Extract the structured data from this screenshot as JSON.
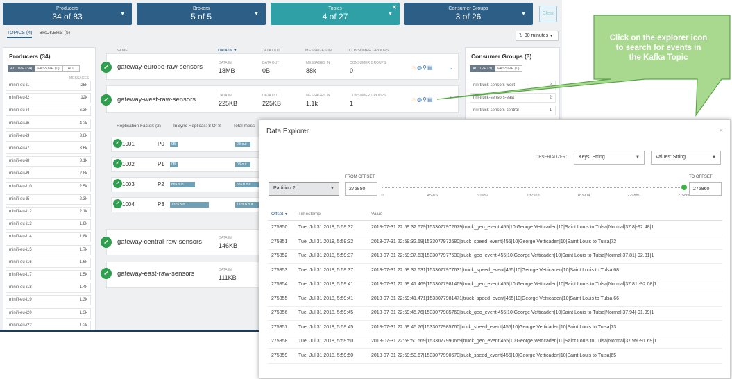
{
  "filters": [
    {
      "label": "Producers",
      "value": "34 of 83"
    },
    {
      "label": "Brokers",
      "value": "5 of 5"
    },
    {
      "label": "Topics",
      "value": "4 of 27"
    },
    {
      "label": "Consumer Groups",
      "value": "3 of 26"
    }
  ],
  "clear_label": "Clear",
  "tabs": {
    "topics": "TOPICS (4)",
    "brokers": "BROKERS (5)"
  },
  "time_range": "30 minutes",
  "producers": {
    "title": "Producers (34)",
    "segments": [
      "ACTIVE (34)",
      "PASSIVE (0)",
      "ALL"
    ],
    "messages_header": "MESSAGES",
    "items": [
      {
        "name": "minifi-eu-i1",
        "value": "25k"
      },
      {
        "name": "minifi-eu-i2",
        "value": "12k"
      },
      {
        "name": "minifi-eu-i4",
        "value": "6.3k"
      },
      {
        "name": "minifi-eu-i6",
        "value": "4.2k"
      },
      {
        "name": "minifi-eu-i3",
        "value": "3.8k"
      },
      {
        "name": "minifi-eu-i7",
        "value": "3.6k"
      },
      {
        "name": "minifi-eu-i8",
        "value": "3.1k"
      },
      {
        "name": "minifi-eu-i9",
        "value": "2.8k"
      },
      {
        "name": "minifi-eu-i10",
        "value": "2.5k"
      },
      {
        "name": "minifi-eu-i5",
        "value": "2.3k"
      },
      {
        "name": "minifi-eu-i12",
        "value": "2.1k"
      },
      {
        "name": "minifi-eu-i13",
        "value": "1.9k"
      },
      {
        "name": "minifi-eu-i14",
        "value": "1.8k"
      },
      {
        "name": "minifi-eu-i15",
        "value": "1.7k"
      },
      {
        "name": "minifi-eu-i16",
        "value": "1.6k"
      },
      {
        "name": "minifi-eu-i17",
        "value": "1.5k"
      },
      {
        "name": "minifi-eu-i18",
        "value": "1.4k"
      },
      {
        "name": "minifi-eu-i19",
        "value": "1.3k"
      },
      {
        "name": "minifi-eu-i20",
        "value": "1.3k"
      },
      {
        "name": "minifi-eu-i22",
        "value": "1.2k"
      }
    ]
  },
  "topic_columns": {
    "name": "NAME",
    "data_in": "DATA IN",
    "data_out": "DATA OUT",
    "messages_in": "MESSAGES IN",
    "consumer_groups": "CONSUMER GROUPS"
  },
  "topics": [
    {
      "name": "gateway-europe-raw-sensors",
      "data_in": "18MB",
      "data_out": "0B",
      "messages_in": "88k",
      "consumer_groups": "0"
    },
    {
      "name": "gateway-west-raw-sensors",
      "data_in": "225KB",
      "data_out": "225KB",
      "messages_in": "1.1k",
      "consumer_groups": "1"
    },
    {
      "name": "gateway-central-raw-sensors",
      "data_in": "146KB"
    },
    {
      "name": "gateway-east-raw-sensors",
      "data_in": "111KB"
    }
  ],
  "topic_detail": {
    "replication": "Replication Factor: (2)",
    "insync": "InSync Replicas: 8 Of 8",
    "total": "Total mess",
    "partitions": [
      {
        "broker": "1001",
        "partition": "P0",
        "in": "0B in",
        "out": "0B out",
        "in_frac": 0.15
      },
      {
        "broker": "1002",
        "partition": "P1",
        "in": "0B in",
        "out": "0B out",
        "in_frac": 0.15
      },
      {
        "broker": "1003",
        "partition": "P2",
        "in": "88KB in",
        "out": "88KB out",
        "in_frac": 0.48
      },
      {
        "broker": "1004",
        "partition": "P3",
        "in": "137KB in",
        "out": "137KB out",
        "in_frac": 0.75
      }
    ]
  },
  "consumer_groups": {
    "title": "Consumer Groups (3)",
    "segments": [
      "ACTIVE (3)",
      "PASSIVE (0)"
    ],
    "items": [
      {
        "name": "nifi-truck-sensors-west",
        "value": "2"
      },
      {
        "name": "nifi-truck-sensors-east",
        "value": "2"
      },
      {
        "name": "nifi-truck-sensors-central",
        "value": "1"
      }
    ]
  },
  "callout": {
    "lines": [
      "Click on the explorer icon",
      "to search for events in",
      "the Kafka Topic"
    ],
    "fill": "#a9d98f",
    "stroke": "#5aa64a"
  },
  "explorer": {
    "title": "Data Explorer",
    "deserializer_label": "DESERIALIZER:",
    "keys": "Keys: String",
    "values": "Values: String",
    "partition": "Partition 2",
    "from_label": "FROM OFFSET",
    "from_value": "275850",
    "to_label": "TO OFFSET",
    "to_value": "275860",
    "ticks": [
      "0",
      "45976",
      "91952",
      "137928",
      "183904",
      "229880",
      "275860"
    ],
    "columns": {
      "offset": "Offset",
      "timestamp": "Timestamp",
      "value": "Value"
    },
    "rows": [
      {
        "offset": "275850",
        "timestamp": "Tue, Jul 31 2018, 5:59:32",
        "value": "2018-07-31 22:59:32.679|1533077972679|truck_geo_event|455|10|George Vetticaden|10|Saint Louis to Tulsa|Normal|37.8|-92.48|1"
      },
      {
        "offset": "275851",
        "timestamp": "Tue, Jul 31 2018, 5:59:32",
        "value": "2018-07-31 22:59:32.68|1533077972680|truck_speed_event|455|10|George Vetticaden|10|Saint Louis to Tulsa|72"
      },
      {
        "offset": "275852",
        "timestamp": "Tue, Jul 31 2018, 5:59:37",
        "value": "2018-07-31 22:59:37.63|1533077977630|truck_geo_event|455|10|George Vetticaden|10|Saint Louis to Tulsa|Normal|37.81|-92.31|1"
      },
      {
        "offset": "275853",
        "timestamp": "Tue, Jul 31 2018, 5:59:37",
        "value": "2018-07-31 22:59:37.631|1533077977631|truck_speed_event|455|10|George Vetticaden|10|Saint Louis to Tulsa|68"
      },
      {
        "offset": "275854",
        "timestamp": "Tue, Jul 31 2018, 5:59:41",
        "value": "2018-07-31 22:59:41.469|1533077981469|truck_geo_event|455|10|George Vetticaden|10|Saint Louis to Tulsa|Normal|37.81|-92.08|1"
      },
      {
        "offset": "275855",
        "timestamp": "Tue, Jul 31 2018, 5:59:41",
        "value": "2018-07-31 22:59:41.471|1533077981471|truck_speed_event|455|10|George Vetticaden|10|Saint Louis to Tulsa|66"
      },
      {
        "offset": "275856",
        "timestamp": "Tue, Jul 31 2018, 5:59:45",
        "value": "2018-07-31 22:59:45.76|1533077985760|truck_geo_event|455|10|George Vetticaden|10|Saint Louis to Tulsa|Normal|37.94|-91.99|1"
      },
      {
        "offset": "275857",
        "timestamp": "Tue, Jul 31 2018, 5:59:45",
        "value": "2018-07-31 22:59:45.76|1533077985760|truck_speed_event|455|10|George Vetticaden|10|Saint Louis to Tulsa|73"
      },
      {
        "offset": "275858",
        "timestamp": "Tue, Jul 31 2018, 5:59:50",
        "value": "2018-07-31 22:59:50.669|1533077990669|truck_geo_event|455|10|George Vetticaden|10|Saint Louis to Tulsa|Normal|37.99|-91.69|1"
      },
      {
        "offset": "275859",
        "timestamp": "Tue, Jul 31 2018, 5:59:50",
        "value": "2018-07-31 22:59:50.67|1533077990670|truck_speed_event|455|10|George Vetticaden|10|Saint Louis to Tulsa|65"
      }
    ]
  },
  "icons": {
    "check": "check-icon",
    "fire": "fire-icon",
    "globe": "globe-icon",
    "search": "search-icon",
    "table": "table-icon",
    "refresh": "refresh-icon"
  }
}
